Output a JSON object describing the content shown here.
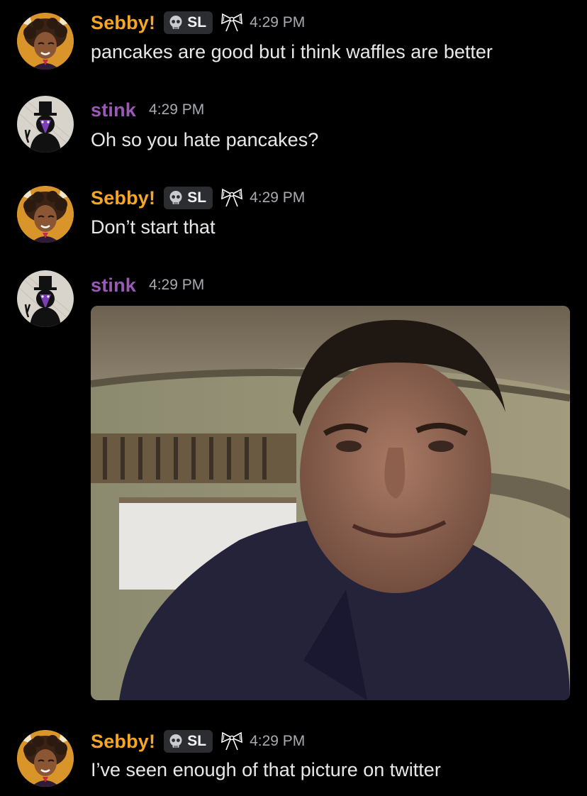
{
  "colors": {
    "background": "#000000",
    "sebby_name": "#f5a623",
    "stink_name": "#9b59b6",
    "timestamp": "#a8aab0",
    "message_text": "#e8e8ea",
    "tag_bg": "#2b2d31"
  },
  "messages": [
    {
      "author": "Sebby!",
      "avatar_icon": "sebby-avatar",
      "tag": "SL",
      "tag_icon": "skull-icon",
      "badge_icon": "bow-icon",
      "time": "4:29 PM",
      "text": "pancakes are good but i think waffles are better"
    },
    {
      "author": "stink",
      "avatar_icon": "stink-avatar",
      "time": "4:29 PM",
      "text": "Oh so you hate pancakes?"
    },
    {
      "author": "Sebby!",
      "avatar_icon": "sebby-avatar",
      "tag": "SL",
      "tag_icon": "skull-icon",
      "badge_icon": "bow-icon",
      "time": "4:29 PM",
      "text": "Don’t start that"
    },
    {
      "author": "stink",
      "avatar_icon": "stink-avatar",
      "time": "4:29 PM",
      "attachment": "image-attachment"
    },
    {
      "author": "Sebby!",
      "avatar_icon": "sebby-avatar",
      "tag": "SL",
      "tag_icon": "skull-icon",
      "badge_icon": "bow-icon",
      "time": "4:29 PM",
      "text": "I’ve seen enough of that picture on twitter"
    }
  ]
}
